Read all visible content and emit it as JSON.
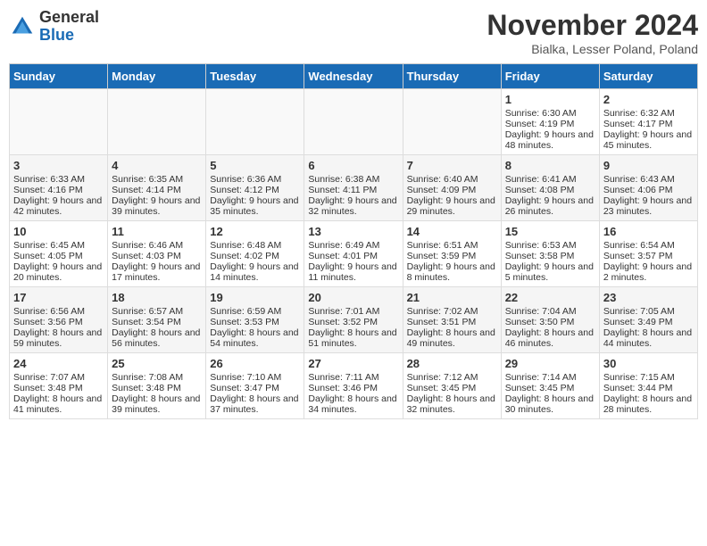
{
  "header": {
    "logo_general": "General",
    "logo_blue": "Blue",
    "month_title": "November 2024",
    "subtitle": "Bialka, Lesser Poland, Poland"
  },
  "days_of_week": [
    "Sunday",
    "Monday",
    "Tuesday",
    "Wednesday",
    "Thursday",
    "Friday",
    "Saturday"
  ],
  "weeks": [
    [
      {
        "day": "",
        "content": ""
      },
      {
        "day": "",
        "content": ""
      },
      {
        "day": "",
        "content": ""
      },
      {
        "day": "",
        "content": ""
      },
      {
        "day": "",
        "content": ""
      },
      {
        "day": "1",
        "content": "Sunrise: 6:30 AM\nSunset: 4:19 PM\nDaylight: 9 hours and 48 minutes."
      },
      {
        "day": "2",
        "content": "Sunrise: 6:32 AM\nSunset: 4:17 PM\nDaylight: 9 hours and 45 minutes."
      }
    ],
    [
      {
        "day": "3",
        "content": "Sunrise: 6:33 AM\nSunset: 4:16 PM\nDaylight: 9 hours and 42 minutes."
      },
      {
        "day": "4",
        "content": "Sunrise: 6:35 AM\nSunset: 4:14 PM\nDaylight: 9 hours and 39 minutes."
      },
      {
        "day": "5",
        "content": "Sunrise: 6:36 AM\nSunset: 4:12 PM\nDaylight: 9 hours and 35 minutes."
      },
      {
        "day": "6",
        "content": "Sunrise: 6:38 AM\nSunset: 4:11 PM\nDaylight: 9 hours and 32 minutes."
      },
      {
        "day": "7",
        "content": "Sunrise: 6:40 AM\nSunset: 4:09 PM\nDaylight: 9 hours and 29 minutes."
      },
      {
        "day": "8",
        "content": "Sunrise: 6:41 AM\nSunset: 4:08 PM\nDaylight: 9 hours and 26 minutes."
      },
      {
        "day": "9",
        "content": "Sunrise: 6:43 AM\nSunset: 4:06 PM\nDaylight: 9 hours and 23 minutes."
      }
    ],
    [
      {
        "day": "10",
        "content": "Sunrise: 6:45 AM\nSunset: 4:05 PM\nDaylight: 9 hours and 20 minutes."
      },
      {
        "day": "11",
        "content": "Sunrise: 6:46 AM\nSunset: 4:03 PM\nDaylight: 9 hours and 17 minutes."
      },
      {
        "day": "12",
        "content": "Sunrise: 6:48 AM\nSunset: 4:02 PM\nDaylight: 9 hours and 14 minutes."
      },
      {
        "day": "13",
        "content": "Sunrise: 6:49 AM\nSunset: 4:01 PM\nDaylight: 9 hours and 11 minutes."
      },
      {
        "day": "14",
        "content": "Sunrise: 6:51 AM\nSunset: 3:59 PM\nDaylight: 9 hours and 8 minutes."
      },
      {
        "day": "15",
        "content": "Sunrise: 6:53 AM\nSunset: 3:58 PM\nDaylight: 9 hours and 5 minutes."
      },
      {
        "day": "16",
        "content": "Sunrise: 6:54 AM\nSunset: 3:57 PM\nDaylight: 9 hours and 2 minutes."
      }
    ],
    [
      {
        "day": "17",
        "content": "Sunrise: 6:56 AM\nSunset: 3:56 PM\nDaylight: 8 hours and 59 minutes."
      },
      {
        "day": "18",
        "content": "Sunrise: 6:57 AM\nSunset: 3:54 PM\nDaylight: 8 hours and 56 minutes."
      },
      {
        "day": "19",
        "content": "Sunrise: 6:59 AM\nSunset: 3:53 PM\nDaylight: 8 hours and 54 minutes."
      },
      {
        "day": "20",
        "content": "Sunrise: 7:01 AM\nSunset: 3:52 PM\nDaylight: 8 hours and 51 minutes."
      },
      {
        "day": "21",
        "content": "Sunrise: 7:02 AM\nSunset: 3:51 PM\nDaylight: 8 hours and 49 minutes."
      },
      {
        "day": "22",
        "content": "Sunrise: 7:04 AM\nSunset: 3:50 PM\nDaylight: 8 hours and 46 minutes."
      },
      {
        "day": "23",
        "content": "Sunrise: 7:05 AM\nSunset: 3:49 PM\nDaylight: 8 hours and 44 minutes."
      }
    ],
    [
      {
        "day": "24",
        "content": "Sunrise: 7:07 AM\nSunset: 3:48 PM\nDaylight: 8 hours and 41 minutes."
      },
      {
        "day": "25",
        "content": "Sunrise: 7:08 AM\nSunset: 3:48 PM\nDaylight: 8 hours and 39 minutes."
      },
      {
        "day": "26",
        "content": "Sunrise: 7:10 AM\nSunset: 3:47 PM\nDaylight: 8 hours and 37 minutes."
      },
      {
        "day": "27",
        "content": "Sunrise: 7:11 AM\nSunset: 3:46 PM\nDaylight: 8 hours and 34 minutes."
      },
      {
        "day": "28",
        "content": "Sunrise: 7:12 AM\nSunset: 3:45 PM\nDaylight: 8 hours and 32 minutes."
      },
      {
        "day": "29",
        "content": "Sunrise: 7:14 AM\nSunset: 3:45 PM\nDaylight: 8 hours and 30 minutes."
      },
      {
        "day": "30",
        "content": "Sunrise: 7:15 AM\nSunset: 3:44 PM\nDaylight: 8 hours and 28 minutes."
      }
    ]
  ]
}
